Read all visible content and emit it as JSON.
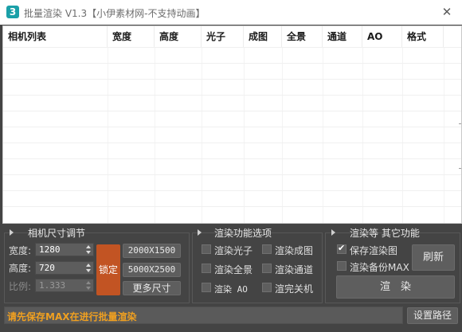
{
  "window": {
    "icon_text": "3",
    "title": "批量渲染 V1.3【小伊素材网-不支持动画】",
    "close_glyph": "✕"
  },
  "table": {
    "columns": [
      "相机列表",
      "宽度",
      "高度",
      "光子",
      "成图",
      "全景",
      "通道",
      "AO",
      "格式"
    ],
    "rows": []
  },
  "camera_size": {
    "title": "相机尺寸调节",
    "width_label": "宽度:",
    "width_value": "1280",
    "height_label": "高度:",
    "height_value": "720",
    "ratio_label": "比例:",
    "ratio_value": "1.333",
    "lock_label": "锁定",
    "preset1": "2000X1500",
    "preset2": "5000X2500",
    "more_sizes": "更多尺寸"
  },
  "render_options": {
    "title": "渲染功能选项",
    "items": [
      {
        "label": "渲染光子",
        "checked": false
      },
      {
        "label": "渲染成图",
        "checked": false
      },
      {
        "label": "渲染全景",
        "checked": false
      },
      {
        "label": "渲染通道",
        "checked": false
      },
      {
        "label": "渲染 AO",
        "checked": false
      },
      {
        "label": "渲完关机",
        "checked": false
      }
    ]
  },
  "other": {
    "title": "渲染等 其它功能",
    "save_render": {
      "label": "保存渲染图",
      "checked": true
    },
    "backup_max": {
      "label": "渲染备份MAX",
      "checked": false
    },
    "refresh": "刷新",
    "render": "渲　染"
  },
  "status": {
    "message": "请先保存MAX在进行批量渲染",
    "message_color": "#f0a020",
    "set_path": "设置路径"
  },
  "colors": {
    "lock_button": "#c25423",
    "panel_bg": "#444444"
  }
}
